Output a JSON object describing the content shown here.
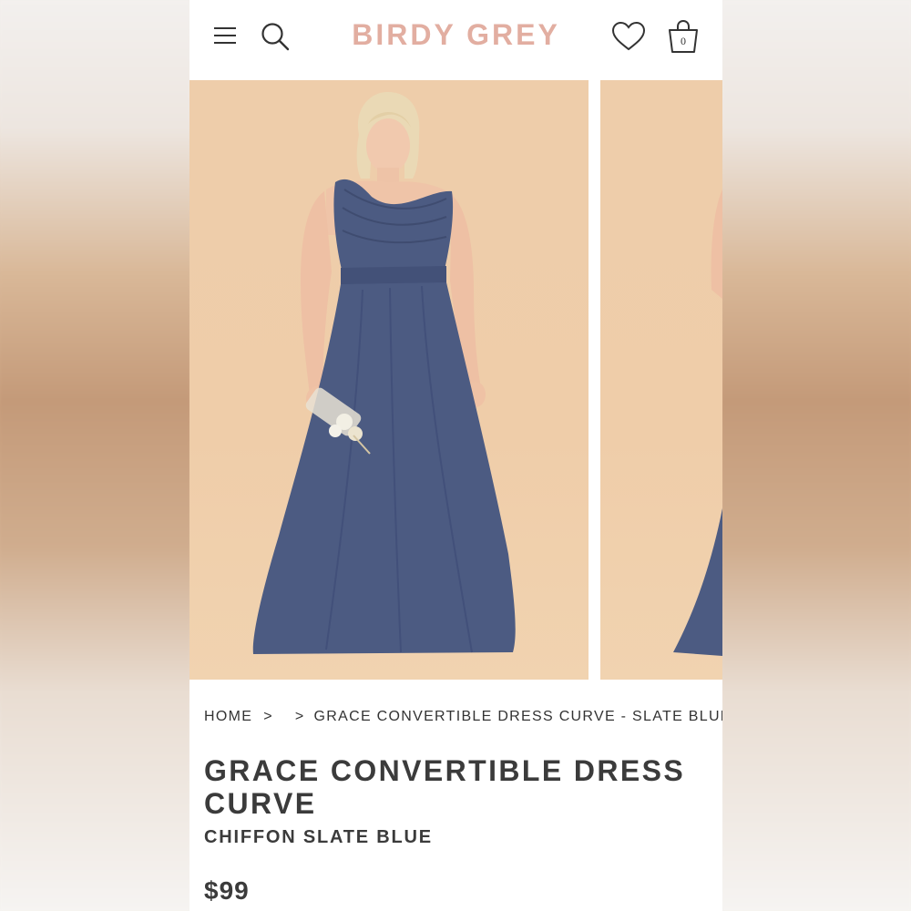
{
  "header": {
    "logo": "BIRDY GREY",
    "bag_count": "0",
    "icons": [
      "menu-icon",
      "search-icon",
      "heart-icon",
      "shopping-bag-icon"
    ]
  },
  "colors": {
    "brand": "#e2aea1",
    "text": "#3b3b3b",
    "dress": "#4c5b82",
    "backdrop": "#ecc9a3"
  },
  "breadcrumb": {
    "home": "HOME",
    "separator": ">",
    "current": "GRACE CONVERTIBLE DRESS CURVE - SLATE BLUE"
  },
  "product": {
    "title": "GRACE CONVERTIBLE DRESS CURVE",
    "subtitle": "CHIFFON SLATE BLUE",
    "price": "$99"
  }
}
